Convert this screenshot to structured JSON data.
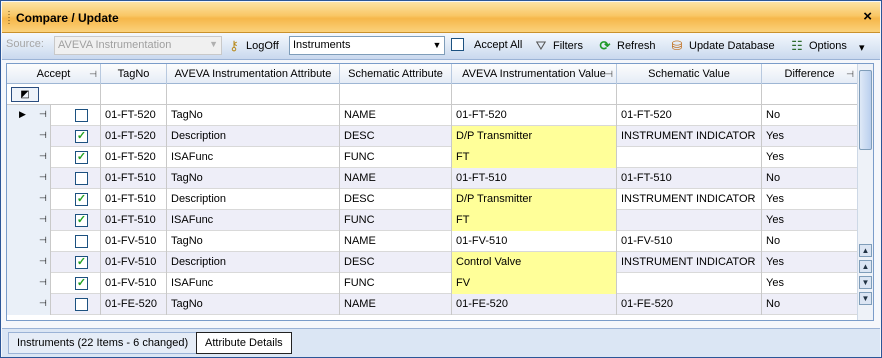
{
  "window": {
    "title": "Compare / Update",
    "close_label": "×"
  },
  "toolbar": {
    "source_label": "Source:",
    "source_value": "AVEVA Instrumentation",
    "logoff_label": "LogOff",
    "instruments_value": "Instruments",
    "accept_all_label": "Accept All",
    "filters_label": "Filters",
    "refresh_label": "Refresh",
    "update_db_label": "Update Database",
    "options_label": "Options"
  },
  "grid": {
    "columns": [
      "Accept",
      "TagNo",
      "AVEVA Instrumentation Attribute",
      "Schematic Attribute",
      "AVEVA Instrumentation Value",
      "Schematic Value",
      "Difference"
    ],
    "rows": [
      {
        "accept": false,
        "tag": "01-FT-520",
        "attr": "TagNo",
        "schem_attr": "NAME",
        "value": "01-FT-520",
        "schem_value": "01-FT-520",
        "diff": "No",
        "highlight": false
      },
      {
        "accept": true,
        "tag": "01-FT-520",
        "attr": "Description",
        "schem_attr": "DESC",
        "value": "D/P Transmitter",
        "schem_value": "INSTRUMENT INDICATOR",
        "diff": "Yes",
        "highlight": true
      },
      {
        "accept": true,
        "tag": "01-FT-520",
        "attr": "ISAFunc",
        "schem_attr": "FUNC",
        "value": "FT",
        "schem_value": "",
        "diff": "Yes",
        "highlight": true
      },
      {
        "accept": false,
        "tag": "01-FT-510",
        "attr": "TagNo",
        "schem_attr": "NAME",
        "value": "01-FT-510",
        "schem_value": "01-FT-510",
        "diff": "No",
        "highlight": false
      },
      {
        "accept": true,
        "tag": "01-FT-510",
        "attr": "Description",
        "schem_attr": "DESC",
        "value": "D/P Transmitter",
        "schem_value": "INSTRUMENT INDICATOR",
        "diff": "Yes",
        "highlight": true
      },
      {
        "accept": true,
        "tag": "01-FT-510",
        "attr": "ISAFunc",
        "schem_attr": "FUNC",
        "value": "FT",
        "schem_value": "",
        "diff": "Yes",
        "highlight": true
      },
      {
        "accept": false,
        "tag": "01-FV-510",
        "attr": "TagNo",
        "schem_attr": "NAME",
        "value": "01-FV-510",
        "schem_value": "01-FV-510",
        "diff": "No",
        "highlight": false
      },
      {
        "accept": true,
        "tag": "01-FV-510",
        "attr": "Description",
        "schem_attr": "DESC",
        "value": "Control Valve",
        "schem_value": "INSTRUMENT INDICATOR",
        "diff": "Yes",
        "highlight": true
      },
      {
        "accept": true,
        "tag": "01-FV-510",
        "attr": "ISAFunc",
        "schem_attr": "FUNC",
        "value": "FV",
        "schem_value": "",
        "diff": "Yes",
        "highlight": true
      },
      {
        "accept": false,
        "tag": "01-FE-520",
        "attr": "TagNo",
        "schem_attr": "NAME",
        "value": "01-FE-520",
        "schem_value": "01-FE-520",
        "diff": "No",
        "highlight": false
      }
    ]
  },
  "tabs": [
    {
      "label": "Instruments (22 Items - 6 changed)"
    },
    {
      "label": "Attribute Details"
    }
  ]
}
